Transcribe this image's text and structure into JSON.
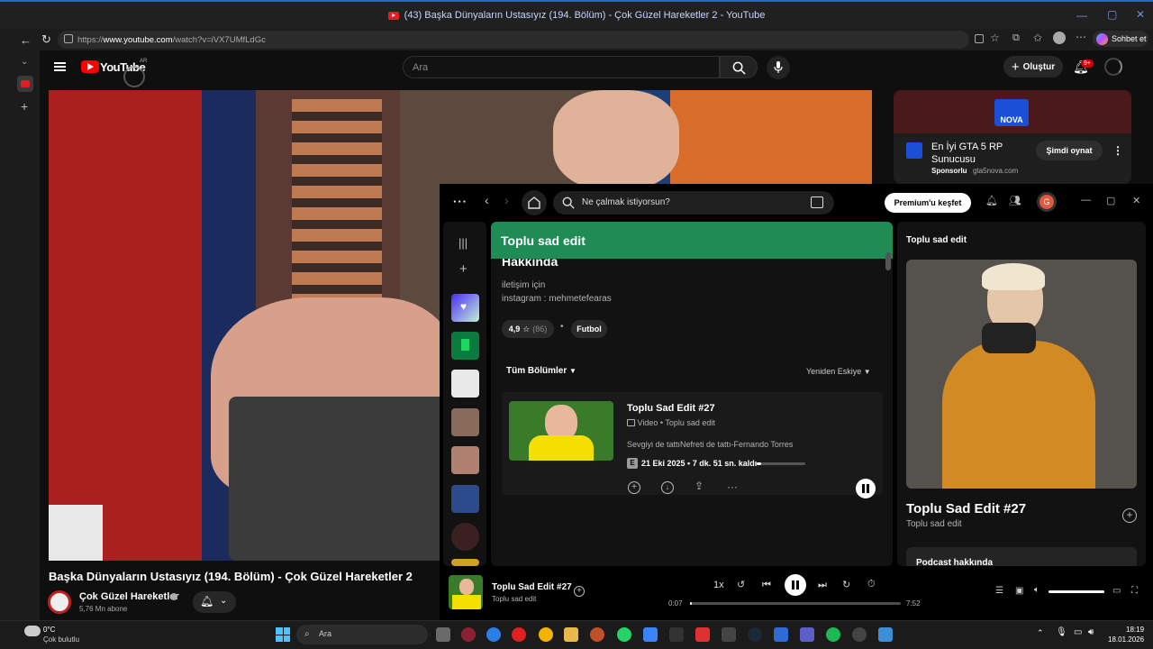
{
  "browser": {
    "window_title": "(43) Başka Dünyaların Ustasıyız (194. Bölüm) - Çok Güzel Hareketler 2 - YouTube",
    "url_prefix": "https://",
    "url_domain": "www.youtube.com",
    "url_path": "/watch?v=iVX7UMfLdGc",
    "chat_button": "Sohbet et"
  },
  "youtube": {
    "logo": "YouTube",
    "logo_region": "AR",
    "search_placeholder": "Ara",
    "create_label": "Oluştur",
    "notifications_badge": "9+",
    "video_title": "Başka Dünyaların Ustasıyız (194. Bölüm) - Çok Güzel Hareketler 2",
    "channel_name": "Çok Güzel Hareketler",
    "subscribers": "5,76 Mn abone",
    "ad": {
      "brand_logo": "NOVA",
      "title": "En İyi GTA 5 RP Sunucusu",
      "sponsored": "Sponsorlu",
      "domain": "gta5nova.com",
      "cta": "Şimdi oynat"
    }
  },
  "spotify": {
    "search_placeholder": "Ne çalmak istiyorsun?",
    "premium_button": "Premium'u keşfet",
    "avatar_letter": "G",
    "show_header": "Toplu sad edit",
    "about_heading": "Hakkında",
    "about_line1": "iletişim için",
    "about_line2": "instagram : mehmetefearas",
    "rating": "4,9",
    "rating_count": "(86)",
    "category": "Futbol",
    "episodes_filter": "Tüm Bölümler",
    "sort": "Yeniden Eskiye",
    "episode": {
      "title": "Toplu Sad Edit #27",
      "type": "Video",
      "show": "Toplu sad edit",
      "description": "Sevgiyi de tattıNefreti de tattı-Fernando Torres",
      "badge": "E",
      "meta": "21 Eki 2025 • 7 dk. 51 sn. kaldı",
      "progress": 0.1
    },
    "right_panel": {
      "header": "Toplu sad edit",
      "title": "Toplu Sad Edit #27",
      "subtitle": "Toplu sad edit",
      "podcast_about": "Podcast hakkında"
    },
    "now_playing": {
      "title": "Toplu Sad Edit #27",
      "subtitle": "Toplu sad edit",
      "speed": "1x",
      "elapsed": "0:07",
      "duration": "7:52",
      "progress": 0.01,
      "volume": 1.0
    },
    "colors": {
      "green": "#1db954",
      "header_green": "#1f8c55"
    }
  },
  "taskbar": {
    "temperature": "0°C",
    "weather": "Çok bulutlu",
    "search_placeholder": "Ara",
    "time": "18:19",
    "date": "18.01.2026"
  }
}
